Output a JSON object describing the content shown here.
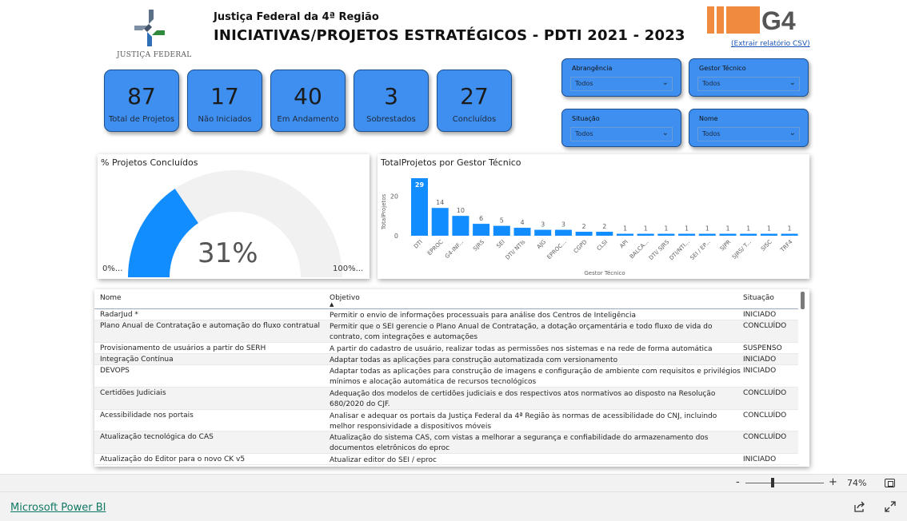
{
  "header": {
    "logo_caption": "JUSTIÇA FEDERAL",
    "org_name": "Justiça Federal da 4ª Região",
    "title": "INICIATIVAS/PROJETOS ESTRATÉGICOS - PDTI 2021 - 2023",
    "g4_logo_text": "G4",
    "csv_link": "(Extrair relatório CSV)"
  },
  "kpis": [
    {
      "value": "87",
      "label": "Total de Projetos"
    },
    {
      "value": "17",
      "label": "Não Iniciados"
    },
    {
      "value": "40",
      "label": "Em Andamento"
    },
    {
      "value": "3",
      "label": "Sobrestados"
    },
    {
      "value": "27",
      "label": "Concluídos"
    }
  ],
  "slicers": [
    {
      "title": "Abrangência",
      "value": "Todos"
    },
    {
      "title": "Gestor Técnico",
      "value": "Todos"
    },
    {
      "title": "Situação",
      "value": "Todos"
    },
    {
      "title": "Nome",
      "value": "Todos"
    }
  ],
  "gauge": {
    "title": "% Projetos Concluídos",
    "value_label": "31%",
    "value": 0.31,
    "min_label": "0%...",
    "max_label": "100%...",
    "fill_color": "#118dff",
    "track_color": "#f1f1f1"
  },
  "chart_data": {
    "type": "bar",
    "title": "TotalProjetos por Gestor Técnico",
    "xlabel": "Gestor Técnico",
    "ylabel": "TotalProjetos",
    "yticks": [
      0,
      20
    ],
    "ylim": [
      0,
      29
    ],
    "bar_color": "#118dff",
    "categories": [
      "DTI",
      "EPROC",
      "G4-INF...",
      "SJRS",
      "SEI",
      "DTI/ NTIs",
      "AJG",
      "EPROC...",
      "CGPD",
      "CLSI",
      "API",
      "BALCA...",
      "DTI/ SJRS",
      "DTI/NTI...",
      "SEI / EP...",
      "SJPR",
      "SJRS/ T...",
      "SISC",
      "TRF4"
    ],
    "values": [
      29,
      14,
      10,
      6,
      5,
      4,
      3,
      3,
      2,
      2,
      1,
      1,
      1,
      1,
      1,
      1,
      1,
      1,
      1
    ]
  },
  "table": {
    "columns": [
      "Nome",
      "Objetivo",
      "Situação"
    ],
    "rows": [
      {
        "nome": "RadarJud *",
        "objetivo": " Permitir o envio de informações processuais para análise dos Centros de Inteligência",
        "situacao": "INICIADO"
      },
      {
        "nome": "Plano Anual de Contratação e automação do fluxo contratual",
        "objetivo": " Permitir que o SEI gerencie o Plano Anual de Contratação, a dotação orçamentária e todo fluxo de vida do contrato, com integrações e automações",
        "situacao": "CONCLUÍDO"
      },
      {
        "nome": "Provisionamento de usuários a partir do SERH",
        "objetivo": "A partir do cadastro de usuário, realizar todas as permissões nos sistemas e na rede de forma automática",
        "situacao": "SUSPENSO"
      },
      {
        "nome": "Integração Contínua",
        "objetivo": "Adaptar todas as aplicações para construção automatizada com versionamento",
        "situacao": "INICIADO"
      },
      {
        "nome": "DEVOPS",
        "objetivo": "Adaptar todas as aplicações para construção de imagens e configuração de ambiente com requisitos e privilégios mínimos e alocação automática de recursos tecnológicos",
        "situacao": "INICIADO"
      },
      {
        "nome": "Certidões Judiciais",
        "objetivo": "Adequação dos modelos de certidões judiciais e dos respectivos atos normativos ao disposto na Resolução 680/2020 do CJF.",
        "situacao": "CONCLUÍDO"
      },
      {
        "nome": "Acessibilidade nos portais",
        "objetivo": "Analisar e adequar os portais da Justiça Federal da 4ª Região às normas de acessibilidade do CNJ, incluindo melhor responsividade a dispositivos móveis",
        "situacao": "CONCLUÍDO"
      },
      {
        "nome": "Atualização tecnológica do CAS",
        "objetivo": "Atualização do sistema CAS, com vistas a melhorar a segurança e confiabilidade do armazenamento dos documentos eletrônicos do eproc",
        "situacao": "CONCLUÍDO"
      },
      {
        "nome": "Atualização do Editor para o novo CK v5",
        "objetivo": "Atualizar editor do SEI / eproc",
        "situacao": "INICIADO"
      }
    ]
  },
  "zoom": {
    "minus": "-",
    "plus": "+",
    "level": "74%",
    "fraction": 0.35
  },
  "footer": {
    "powerbi_link": "Microsoft Power BI"
  }
}
